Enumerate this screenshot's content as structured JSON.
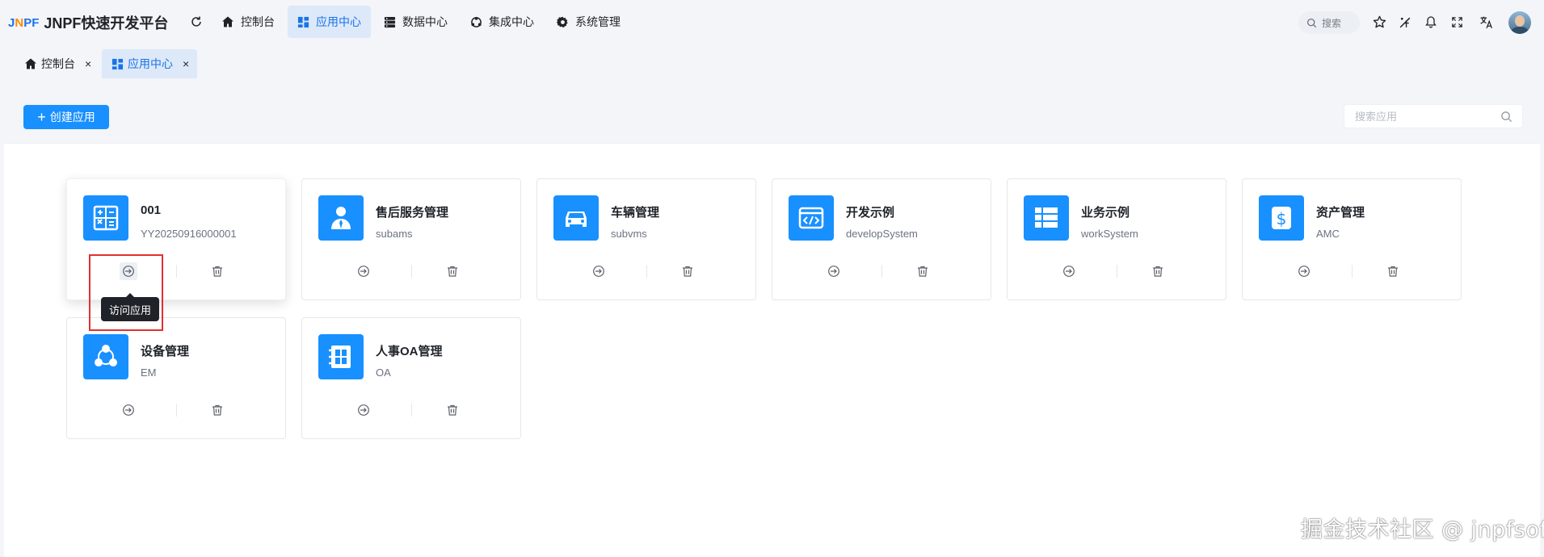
{
  "logo": {
    "mark_jn": "J",
    "mark_n": "N",
    "mark_pf": "PF",
    "title": "JNPF快速开发平台"
  },
  "nav": {
    "items": [
      {
        "label": "控制台",
        "icon": "home-icon"
      },
      {
        "label": "应用中心",
        "icon": "apps-icon",
        "active": true
      },
      {
        "label": "数据中心",
        "icon": "database-icon"
      },
      {
        "label": "集成中心",
        "icon": "integration-icon"
      },
      {
        "label": "系统管理",
        "icon": "gear-icon"
      }
    ],
    "search_label": "搜索"
  },
  "tabs": [
    {
      "label": "控制台",
      "close": "×"
    },
    {
      "label": "应用中心",
      "close": "×",
      "active": true
    }
  ],
  "toolbar": {
    "create_label": "创建应用",
    "search_placeholder": "搜索应用"
  },
  "apps": [
    {
      "name": "001",
      "code": "YY20250916000001",
      "icon": "calculator-icon"
    },
    {
      "name": "售后服务管理",
      "code": "subams",
      "icon": "user-icon"
    },
    {
      "name": "车辆管理",
      "code": "subvms",
      "icon": "car-icon"
    },
    {
      "name": "开发示例",
      "code": "developSystem",
      "icon": "code-window-icon"
    },
    {
      "name": "业务示例",
      "code": "workSystem",
      "icon": "table-icon"
    },
    {
      "name": "资产管理",
      "code": "AMC",
      "icon": "dollar-icon"
    },
    {
      "name": "设备管理",
      "code": "EM",
      "icon": "network-icon"
    },
    {
      "name": "人事OA管理",
      "code": "OA",
      "icon": "oa-icon"
    }
  ],
  "tooltip": "访问应用",
  "watermark": "掘金技术社区 @ jnpfsoft",
  "colors": {
    "primary": "#1890ff",
    "active_bg": "#dde9f9",
    "highlight": "#e03131"
  }
}
